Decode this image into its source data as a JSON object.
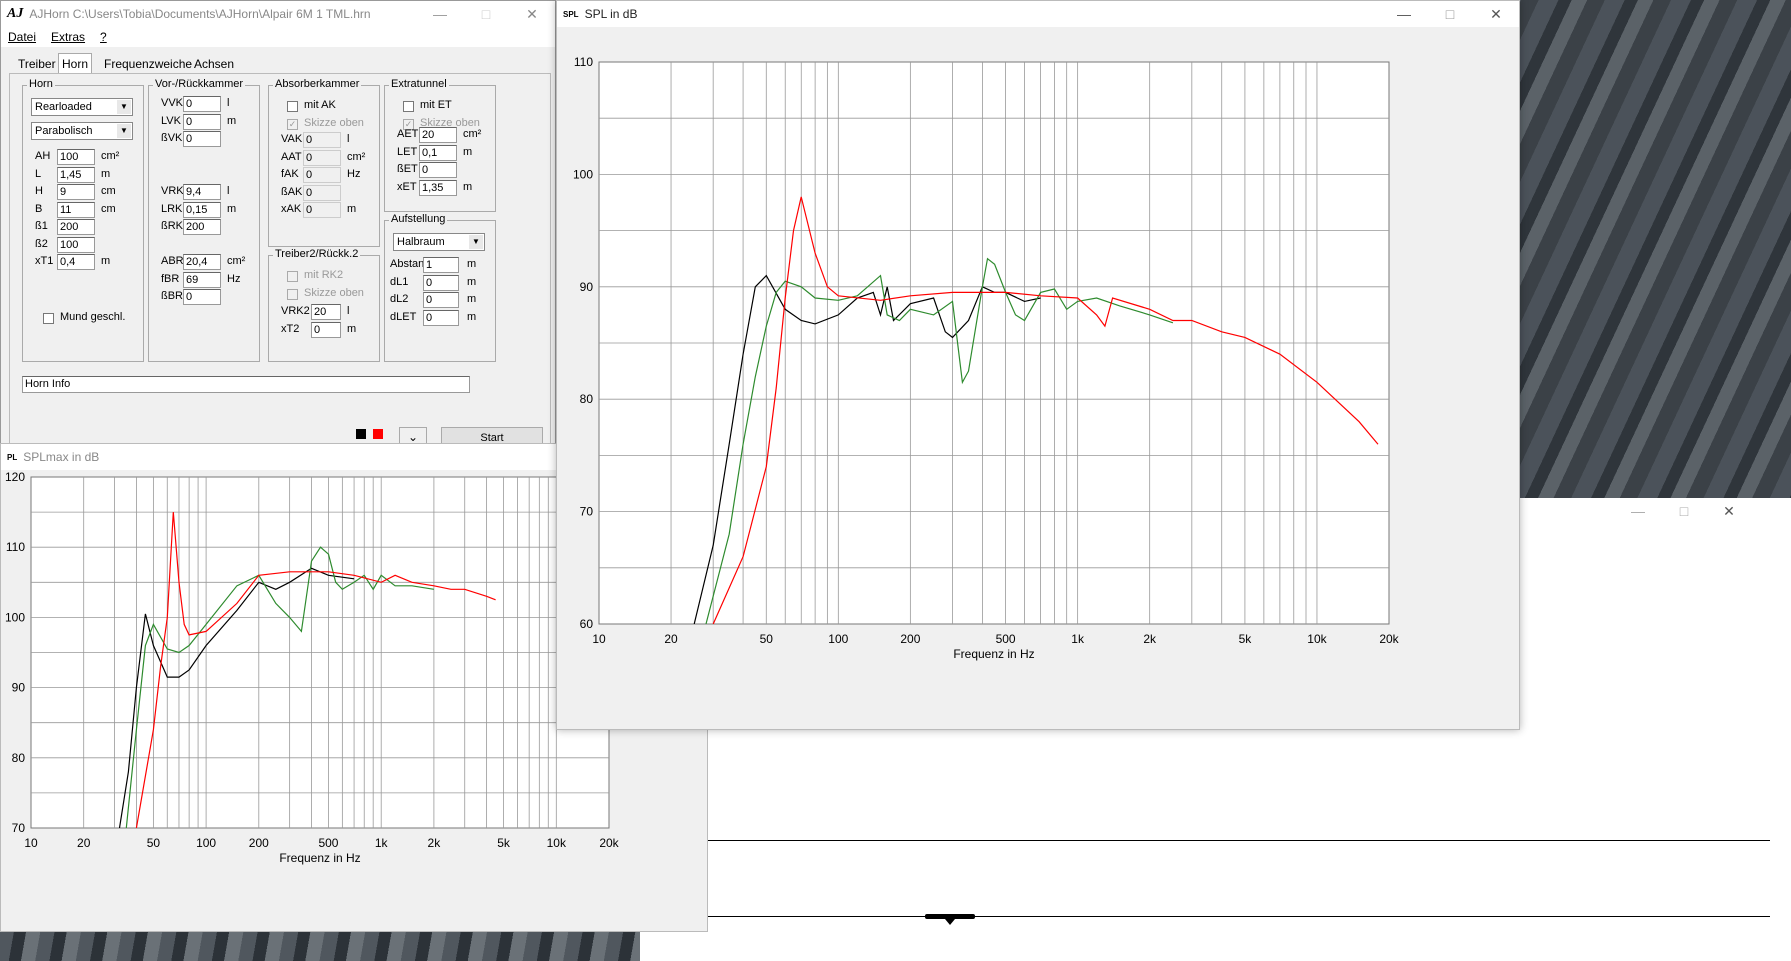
{
  "main_window": {
    "title": "AJHorn  C:\\Users\\Tobia\\Documents\\AJHorn\\Alpair 6M 1 TML.hrn",
    "menu": [
      "Datei",
      "Extras",
      "?"
    ],
    "tabs": [
      "Treiber",
      "Horn",
      "Frequenzweiche",
      "Achsen"
    ],
    "active_tab": "Horn",
    "horn_group": {
      "label": "Horn",
      "type_value": "Rearloaded",
      "profile_value": "Parabolisch",
      "fields": [
        {
          "label": "AH",
          "value": "100",
          "unit": "cm²"
        },
        {
          "label": "L",
          "value": "1,45",
          "unit": "m"
        },
        {
          "label": "H",
          "value": "9",
          "unit": "cm"
        },
        {
          "label": "B",
          "value": "11",
          "unit": "cm"
        },
        {
          "label": "ß1",
          "value": "200",
          "unit": ""
        },
        {
          "label": "ß2",
          "value": "100",
          "unit": ""
        },
        {
          "label": "xT1",
          "value": "0,4",
          "unit": "m"
        }
      ],
      "checkbox_label": "Mund geschl."
    },
    "vor_group": {
      "label": "Vor-/Rückkammer",
      "fields_top": [
        {
          "label": "VVK",
          "value": "0",
          "unit": "l"
        },
        {
          "label": "LVK",
          "value": "0",
          "unit": "m"
        },
        {
          "label": "ßVK",
          "value": "0",
          "unit": ""
        }
      ],
      "fields_mid": [
        {
          "label": "VRK",
          "value": "9,4",
          "unit": "l"
        },
        {
          "label": "LRK",
          "value": "0,15",
          "unit": "m"
        },
        {
          "label": "ßRK",
          "value": "200",
          "unit": ""
        }
      ],
      "fields_bot": [
        {
          "label": "ABR",
          "value": "20,4",
          "unit": "cm²"
        },
        {
          "label": "fBR",
          "value": "69",
          "unit": "Hz"
        },
        {
          "label": "ßBR",
          "value": "0",
          "unit": ""
        }
      ]
    },
    "absorber_group": {
      "label": "Absorberkammer",
      "check1": "mit AK",
      "check2": "Skizze oben",
      "fields": [
        {
          "label": "VAK",
          "value": "0",
          "unit": "l"
        },
        {
          "label": "AAT",
          "value": "0",
          "unit": "cm²"
        },
        {
          "label": "fAK",
          "value": "0",
          "unit": "Hz"
        },
        {
          "label": "ßAK",
          "value": "0",
          "unit": ""
        },
        {
          "label": "xAK",
          "value": "0",
          "unit": "m"
        }
      ]
    },
    "treiber2_group": {
      "label": "Treiber2/Rückk.2",
      "check1": "mit RK2",
      "check2": "Skizze oben",
      "fields": [
        {
          "label": "VRK2",
          "value": "20",
          "unit": "l"
        },
        {
          "label": "xT2",
          "value": "0",
          "unit": "m"
        }
      ]
    },
    "extratunnel_group": {
      "label": "Extratunnel",
      "check1": "mit ET",
      "check2": "Skizze oben",
      "fields": [
        {
          "label": "AET",
          "value": "20",
          "unit": "cm²"
        },
        {
          "label": "LET",
          "value": "0,1",
          "unit": "m"
        },
        {
          "label": "ßET",
          "value": "0",
          "unit": ""
        },
        {
          "label": "xET",
          "value": "1,35",
          "unit": "m"
        }
      ]
    },
    "aufstellung_group": {
      "label": "Aufstellung",
      "combo_value": "Halbraum",
      "fields": [
        {
          "label": "Abstand",
          "value": "1",
          "unit": "m"
        },
        {
          "label": "dL1",
          "value": "0",
          "unit": "m"
        },
        {
          "label": "dL2",
          "value": "0",
          "unit": "m"
        },
        {
          "label": "dLET",
          "value": "0",
          "unit": "m"
        }
      ]
    },
    "info_value": "Horn Info",
    "start_label": "Start",
    "color_swatches": [
      "#000000",
      "#ff0000"
    ]
  },
  "spl_window": {
    "icon_text": "SPL",
    "title": "SPL in dB"
  },
  "splmax_window": {
    "icon_text": "PL",
    "title": "SPLmax in dB"
  },
  "colors": {
    "black": "#000000",
    "red": "#ff0000",
    "green": "#2e8b2e",
    "grid": "#999999"
  },
  "chart_data": [
    {
      "type": "line",
      "title": "SPL in dB",
      "xlabel": "Frequenz in Hz",
      "ylabel": "",
      "xscale": "log",
      "xlim": [
        10,
        20000
      ],
      "ylim": [
        60,
        110
      ],
      "xticks": [
        "10",
        "20",
        "50",
        "100",
        "200",
        "500",
        "1k",
        "2k",
        "5k",
        "10k",
        "20k"
      ],
      "yticks": [
        "60",
        "70",
        "80",
        "90",
        "100",
        "110"
      ],
      "series": [
        {
          "color": "black",
          "x": [
            25,
            30,
            35,
            40,
            45,
            50,
            60,
            70,
            80,
            100,
            120,
            140,
            150,
            160,
            170,
            200,
            250,
            280,
            300,
            350,
            400,
            450,
            500,
            600,
            700
          ],
          "y": [
            60,
            67,
            76,
            84,
            90,
            91,
            88,
            87,
            86.7,
            87.5,
            89,
            89.5,
            87.5,
            90,
            87,
            88.5,
            89,
            86,
            85.5,
            87,
            90,
            89.5,
            89.5,
            88.7,
            89
          ]
        },
        {
          "color": "green",
          "x": [
            28,
            35,
            40,
            45,
            50,
            55,
            60,
            70,
            80,
            100,
            120,
            150,
            160,
            180,
            200,
            250,
            300,
            330,
            350,
            400,
            420,
            450,
            500,
            550,
            600,
            700,
            800,
            900,
            1000,
            1200,
            1500,
            2000,
            2500
          ],
          "y": [
            60,
            68,
            76,
            82,
            86.5,
            89.5,
            90.5,
            90,
            89,
            88.8,
            89.2,
            91,
            87.5,
            87,
            88,
            87.5,
            88.7,
            81.5,
            82.5,
            90,
            92.5,
            92,
            89.5,
            87.5,
            87,
            89.5,
            89.8,
            88,
            88.7,
            89,
            88.3,
            87.5,
            86.8
          ]
        },
        {
          "color": "red",
          "x": [
            30,
            40,
            50,
            55,
            60,
            65,
            70,
            80,
            90,
            100,
            150,
            200,
            300,
            500,
            700,
            1000,
            1200,
            1300,
            1400,
            2000,
            2500,
            3000,
            4000,
            5000,
            7000,
            10000,
            15000,
            18000
          ],
          "y": [
            60,
            66,
            74,
            81,
            89,
            95,
            98,
            93,
            90,
            89.2,
            88.8,
            89.2,
            89.5,
            89.5,
            89.2,
            89,
            87.5,
            86.5,
            89,
            88,
            87,
            87,
            86,
            85.5,
            84,
            81.5,
            78,
            76
          ]
        }
      ]
    },
    {
      "type": "line",
      "title": "SPLmax in dB",
      "xlabel": "Frequenz in Hz",
      "ylabel": "",
      "xscale": "log",
      "xlim": [
        10,
        20000
      ],
      "ylim": [
        70,
        120
      ],
      "xticks": [
        "10",
        "20",
        "50",
        "100",
        "200",
        "500",
        "1k",
        "2k",
        "5k",
        "10k",
        "20k"
      ],
      "yticks": [
        "70",
        "80",
        "90",
        "100",
        "110",
        "120"
      ],
      "series": [
        {
          "color": "black",
          "x": [
            32,
            36,
            40,
            45,
            50,
            60,
            70,
            80,
            100,
            150,
            200,
            250,
            300,
            400,
            500,
            700
          ],
          "y": [
            70,
            78,
            90,
            100.5,
            96,
            91.5,
            91.5,
            92.5,
            96,
            101,
            105,
            104,
            105,
            107,
            106,
            105.5
          ]
        },
        {
          "color": "green",
          "x": [
            35,
            40,
            45,
            50,
            60,
            70,
            80,
            100,
            150,
            200,
            250,
            300,
            350,
            400,
            450,
            500,
            550,
            600,
            700,
            800,
            900,
            1000,
            1200,
            1500,
            2000
          ],
          "y": [
            70,
            84,
            96,
            99,
            95.5,
            95,
            96,
            99,
            104.5,
            106,
            102,
            100,
            98,
            108,
            110,
            109,
            105,
            104,
            105,
            106,
            104,
            106,
            104.5,
            104.5,
            104
          ]
        },
        {
          "color": "red",
          "x": [
            40,
            50,
            55,
            60,
            65,
            70,
            75,
            80,
            100,
            150,
            200,
            300,
            500,
            700,
            1000,
            1200,
            1500,
            2000,
            2500,
            3000,
            4000,
            4500
          ],
          "y": [
            70,
            84,
            93,
            100,
            115,
            105,
            99,
            97.5,
            98,
            102,
            106,
            106.5,
            106.5,
            106,
            105,
            106,
            105,
            104.5,
            104,
            104,
            103,
            102.5
          ]
        }
      ]
    }
  ]
}
